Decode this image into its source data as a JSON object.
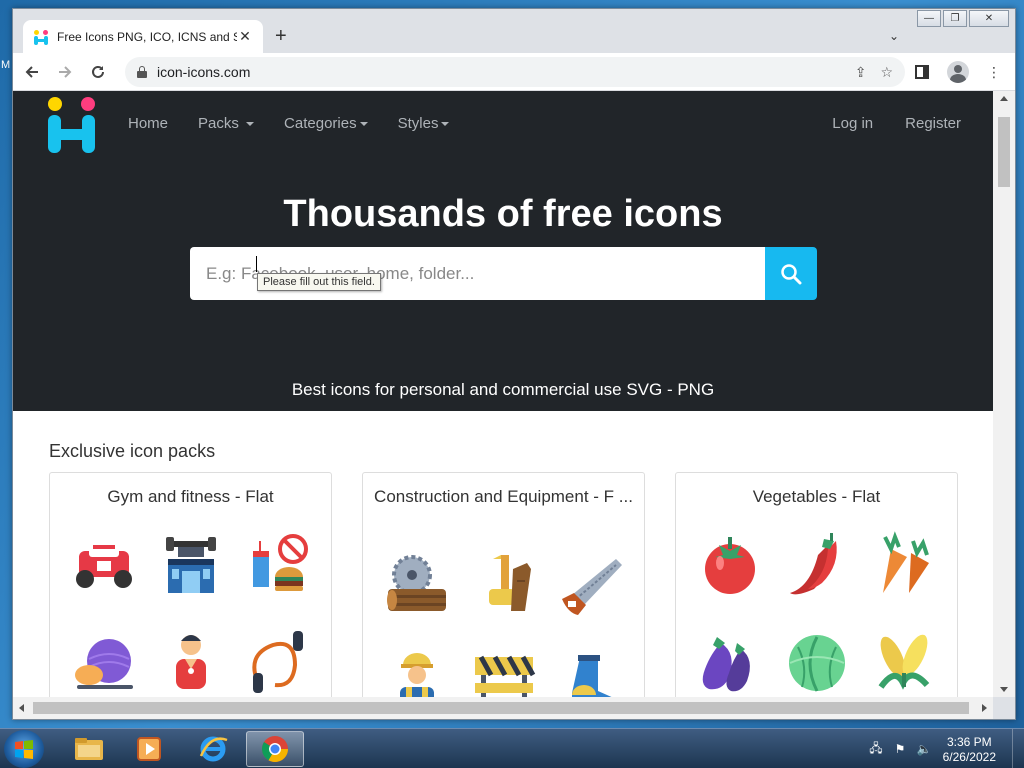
{
  "browser": {
    "tab_title": "Free Icons PNG, ICO, ICNS and S",
    "url": "icon-icons.com"
  },
  "site": {
    "nav": {
      "home": "Home",
      "packs": "Packs",
      "categories": "Categories",
      "styles": "Styles",
      "login": "Log in",
      "register": "Register"
    },
    "hero_title": "Thousands of free icons",
    "search_placeholder": "E.g: Facebook, user, home, folder...",
    "tooltip": "Please fill out this field.",
    "hero_subtitle": "Best icons for personal and commercial use SVG - PNG",
    "section_title": "Exclusive icon packs",
    "packs": [
      {
        "title": "Gym and fitness - Flat",
        "icons": [
          "rowing-machine-icon",
          "gym-building-icon",
          "no-junk-food-icon",
          "yoga-ball-icon",
          "trainer-icon",
          "jump-rope-icon"
        ]
      },
      {
        "title": "Construction and Equipment - F ...",
        "icons": [
          "saw-mill-icon",
          "chainsaw-icon",
          "hand-saw-icon",
          "worker-icon",
          "barrier-icon",
          "boot-icon"
        ]
      },
      {
        "title": "Vegetables - Flat",
        "icons": [
          "tomato-icon",
          "chili-pepper-icon",
          "carrot-icon",
          "eggplant-icon",
          "cabbage-icon",
          "corn-icon"
        ]
      }
    ]
  },
  "taskbar": {
    "time": "3:36 PM",
    "date": "6/26/2022"
  },
  "colors": {
    "hero_bg": "#212529",
    "accent": "#17b9f0",
    "logo_yellow": "#ffd600",
    "logo_pink": "#ff3d7f"
  }
}
